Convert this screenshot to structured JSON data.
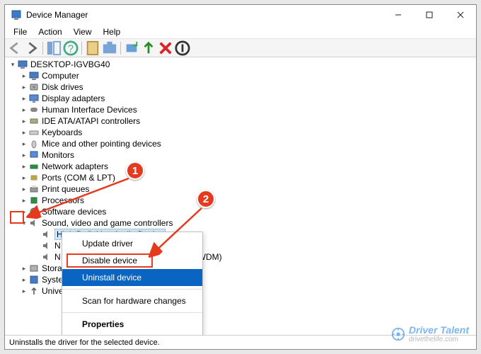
{
  "window": {
    "title": "Device Manager"
  },
  "menu": {
    "file": "File",
    "action": "Action",
    "view": "View",
    "help": "Help"
  },
  "status": {
    "text": "Uninstalls the driver for the selected device."
  },
  "root": "DESKTOP-IGVBG40",
  "categories": [
    "Computer",
    "Disk drives",
    "Display adapters",
    "Human Interface Devices",
    "IDE ATA/ATAPI controllers",
    "Keyboards",
    "Mice and other pointing devices",
    "Monitors",
    "Network adapters",
    "Ports (COM & LPT)",
    "Print queues",
    "Processors",
    "Software devices"
  ],
  "expanded": {
    "name": "Sound, video and game controllers",
    "children": [
      "High Definition Audio Device",
      "N",
      "N"
    ],
    "extra_after_menu": "(WDM)"
  },
  "tail": [
    "Stora",
    "Syste",
    "Unive"
  ],
  "context_menu": {
    "items": [
      "Update driver",
      "Disable device",
      "Uninstall device",
      "Scan for hardware changes",
      "Properties"
    ],
    "hover_index": 2,
    "bold_index": 4
  },
  "callouts": {
    "one": "1",
    "two": "2"
  },
  "watermark": {
    "brand": "Driver Talent",
    "site": "drivethelife.com"
  }
}
